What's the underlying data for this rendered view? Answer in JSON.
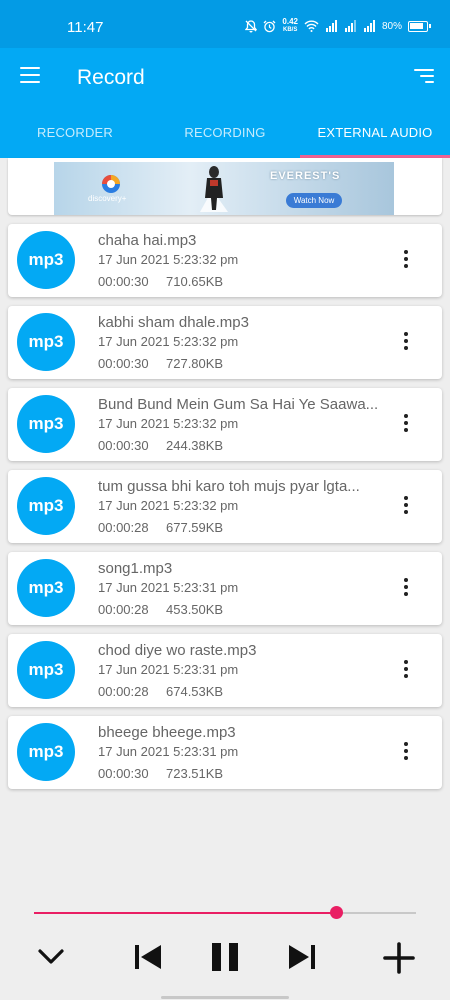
{
  "status": {
    "time": "11:47",
    "net_speed_value": "0.42",
    "net_speed_unit": "KB/S",
    "battery": "80%"
  },
  "appbar": {
    "title": "Record"
  },
  "tabs": [
    {
      "label": "RECORDER",
      "active": false
    },
    {
      "label": "RECORDING",
      "active": false
    },
    {
      "label": "EXTERNAL AUDIO",
      "active": true
    }
  ],
  "ad": {
    "brand": "discovery+",
    "headline": "EVEREST'S",
    "cta": "Watch Now"
  },
  "recordings": [
    {
      "badge": "mp3",
      "name": "chaha hai.mp3",
      "date": "17 Jun 2021 5:23:32 pm",
      "duration": "00:00:30",
      "size": "710.65KB"
    },
    {
      "badge": "mp3",
      "name": "kabhi sham dhale.mp3",
      "date": "17 Jun 2021 5:23:32 pm",
      "duration": "00:00:30",
      "size": "727.80KB"
    },
    {
      "badge": "mp3",
      "name": "Bund Bund Mein Gum Sa Hai Ye Saawa...",
      "date": "17 Jun 2021 5:23:32 pm",
      "duration": "00:00:30",
      "size": "244.38KB"
    },
    {
      "badge": "mp3",
      "name": "tum gussa bhi karo toh mujs pyar lgta...",
      "date": "17 Jun 2021 5:23:32 pm",
      "duration": "00:00:28",
      "size": "677.59KB"
    },
    {
      "badge": "mp3",
      "name": "song1.mp3",
      "date": "17 Jun 2021 5:23:31 pm",
      "duration": "00:00:28",
      "size": "453.50KB"
    },
    {
      "badge": "mp3",
      "name": "chod diye wo raste.mp3",
      "date": "17 Jun 2021 5:23:31 pm",
      "duration": "00:00:28",
      "size": "674.53KB"
    },
    {
      "badge": "mp3",
      "name": "bheege bheege.mp3",
      "date": "17 Jun 2021 5:23:31 pm",
      "duration": "00:00:30",
      "size": "723.51KB"
    }
  ],
  "player": {
    "progress": 0.79,
    "icons": [
      "chevron-down-icon",
      "skip-previous-icon",
      "pause-icon",
      "skip-next-icon",
      "plus-icon"
    ]
  },
  "colors": {
    "status_bar": "#039be5",
    "primary": "#03a9f4",
    "accent": "#e91e63",
    "tab_indicator": "#f06292"
  }
}
